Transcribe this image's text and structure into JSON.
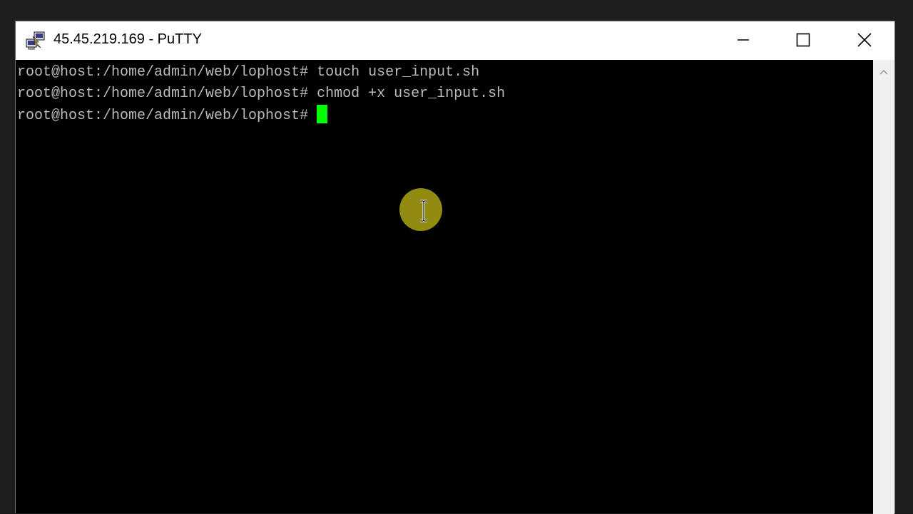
{
  "window": {
    "title": "45.45.219.169 - PuTTY",
    "app_icon": "putty-icon",
    "controls": {
      "minimize_icon": "minimize-icon",
      "maximize_icon": "maximize-icon",
      "close_icon": "close-icon"
    }
  },
  "terminal": {
    "background": "#000000",
    "text_color": "#bbbbbb",
    "cursor_color": "#00ff00",
    "lines": [
      "root@host:/home/admin/web/lophost# touch user_input.sh",
      "root@host:/home/admin/web/lophost# chmod +x user_input.sh",
      "root@host:/home/admin/web/lophost# "
    ]
  },
  "scrollbar": {
    "up_icon": "chevron-up-icon"
  },
  "mouse": {
    "cursor_icon": "ibeam-cursor-icon",
    "highlight_color": "#aaa514"
  }
}
